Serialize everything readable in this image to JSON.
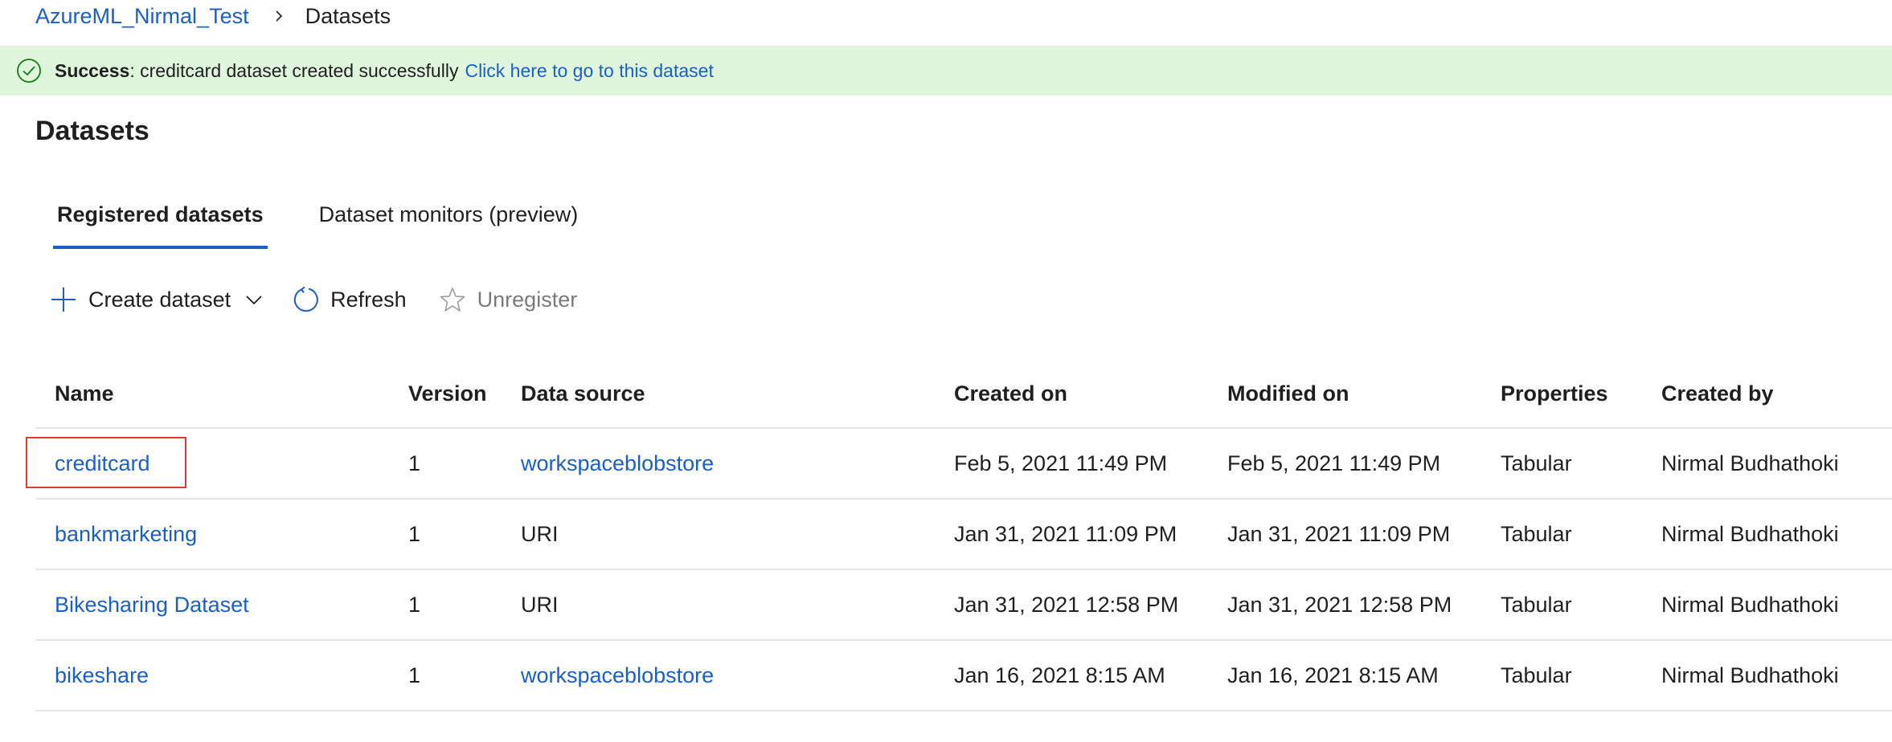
{
  "breadcrumb": {
    "workspace": "AzureML_Nirmal_Test",
    "current": "Datasets"
  },
  "banner": {
    "label": "Success",
    "message": ": creditcard dataset created successfully",
    "link_text": "Click here to go to this dataset",
    "icon": "checkmark-circle-icon"
  },
  "page": {
    "title": "Datasets"
  },
  "tabs": [
    {
      "label": "Registered datasets",
      "active": true
    },
    {
      "label": "Dataset monitors (preview)",
      "active": false
    }
  ],
  "toolbar": {
    "create_label": "Create dataset",
    "refresh_label": "Refresh",
    "unregister_label": "Unregister"
  },
  "table": {
    "columns": [
      "Name",
      "Version",
      "Data source",
      "Created on",
      "Modified on",
      "Properties",
      "Created by"
    ],
    "rows": [
      {
        "name": "creditcard",
        "version": "1",
        "source": "workspaceblobstore",
        "created": "Feb 5, 2021 11:49 PM",
        "modified": "Feb 5, 2021 11:49 PM",
        "properties": "Tabular",
        "created_by": "Nirmal Budhathoki"
      },
      {
        "name": "bankmarketing",
        "version": "1",
        "source": "URI",
        "created": "Jan 31, 2021 11:09 PM",
        "modified": "Jan 31, 2021 11:09 PM",
        "properties": "Tabular",
        "created_by": "Nirmal Budhathoki"
      },
      {
        "name": "Bikesharing Dataset",
        "version": "1",
        "source": "URI",
        "created": "Jan 31, 2021 12:58 PM",
        "modified": "Jan 31, 2021 12:58 PM",
        "properties": "Tabular",
        "created_by": "Nirmal Budhathoki"
      },
      {
        "name": "bikeshare",
        "version": "1",
        "source": "workspaceblobstore",
        "created": "Jan 16, 2021 8:15 AM",
        "modified": "Jan 16, 2021 8:15 AM",
        "properties": "Tabular",
        "created_by": "Nirmal Budhathoki"
      }
    ]
  },
  "colors": {
    "link": "#1a5fc4",
    "success_bg": "#dff6dd",
    "success_icon": "#107c10",
    "highlight": "#e03a2f"
  }
}
